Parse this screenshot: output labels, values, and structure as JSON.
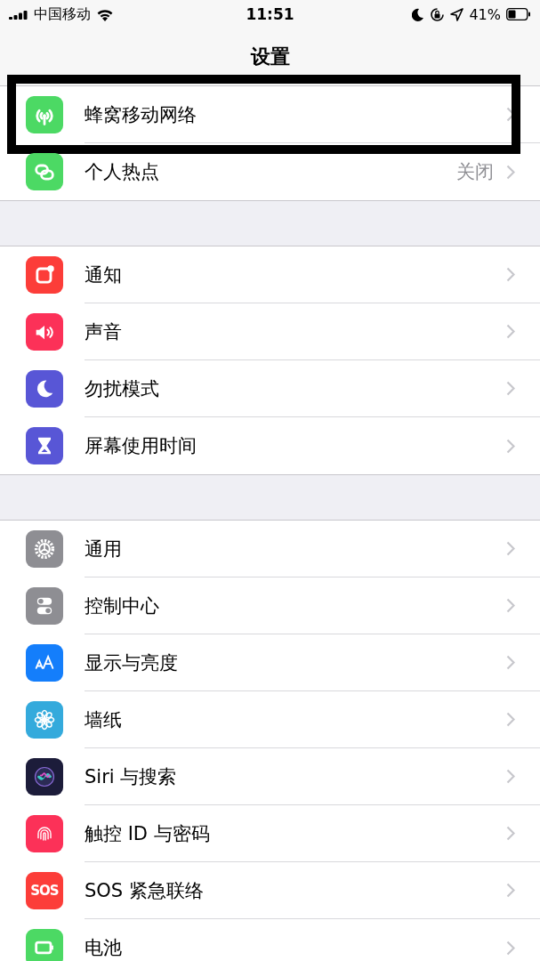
{
  "status_bar": {
    "carrier": "中国移动",
    "time": "11:51",
    "battery": "41%"
  },
  "title": "设置",
  "groups": [
    {
      "rows": [
        {
          "label": "蜂窝移动网络",
          "color": "#4cd964",
          "highlighted": true
        },
        {
          "label": "个人热点",
          "value": "关闭",
          "color": "#4cd964",
          "highlighted": false
        }
      ]
    },
    {
      "rows": [
        {
          "label": "通知",
          "color": "#fc3d39",
          "highlighted": false
        },
        {
          "label": "声音",
          "color": "#fc3158",
          "highlighted": false
        },
        {
          "label": "勿扰模式",
          "color": "#5856d6",
          "highlighted": false
        },
        {
          "label": "屏幕使用时间",
          "color": "#5856d6",
          "highlighted": false
        }
      ]
    },
    {
      "rows": [
        {
          "label": "通用",
          "color": "#8e8e93",
          "highlighted": false
        },
        {
          "label": "控制中心",
          "color": "#8e8e93",
          "highlighted": false
        },
        {
          "label": "显示与亮度",
          "color": "#147efb",
          "highlighted": false
        },
        {
          "label": "墙纸",
          "color": "#34aadc",
          "highlighted": false
        },
        {
          "label": "Siri 与搜索",
          "color": "#1c1c3a",
          "highlighted": false
        },
        {
          "label": "触控 ID 与密码",
          "color": "#fc3158",
          "highlighted": false
        },
        {
          "label": "SOS 紧急联络",
          "icon_text": "SOS",
          "color": "#fc3d39",
          "highlighted": false
        },
        {
          "label": "电池",
          "color": "#4cd964",
          "highlighted": false
        }
      ]
    }
  ]
}
